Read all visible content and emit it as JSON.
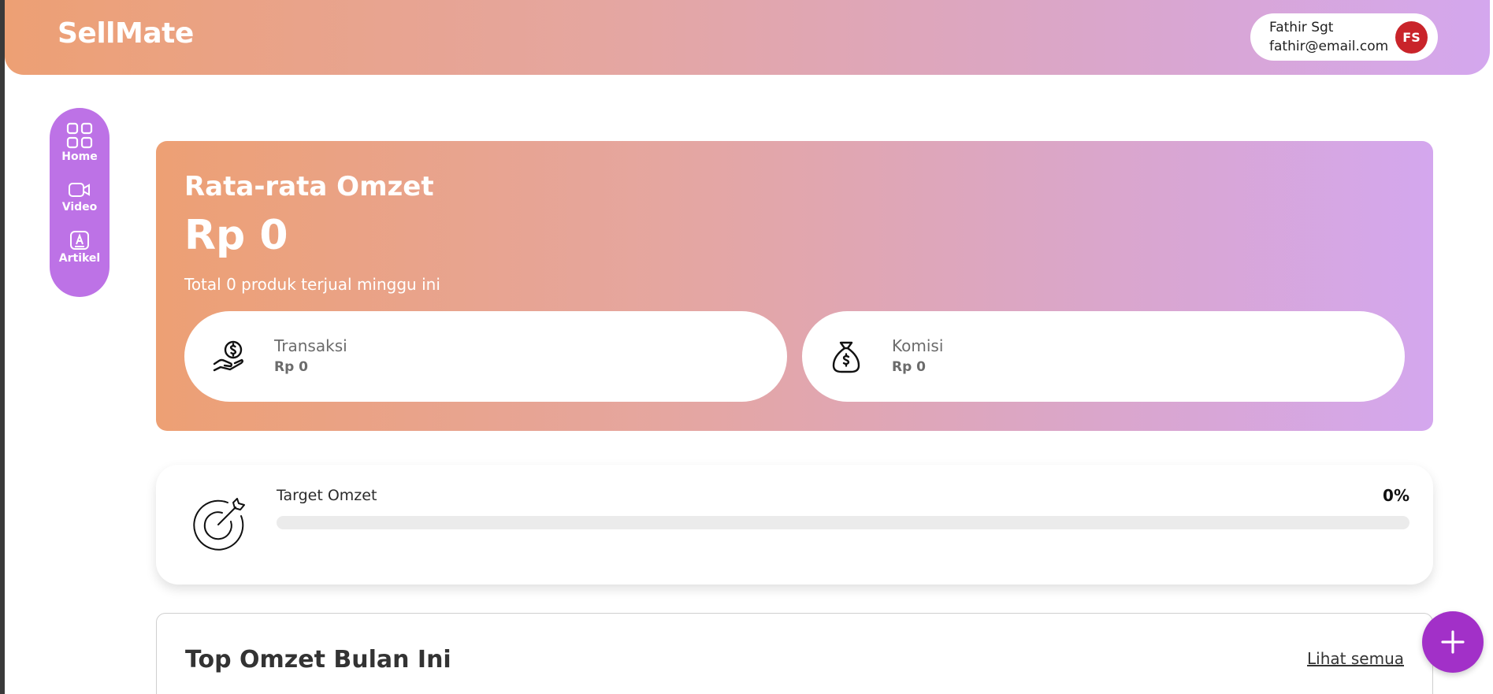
{
  "header": {
    "brand": "SellMate",
    "user": {
      "name": "Fathir Sgt",
      "email": "fathir@email.com",
      "initials": "FS"
    }
  },
  "sidebar": {
    "items": [
      {
        "label": "Home",
        "icon": "grid-icon"
      },
      {
        "label": "Video",
        "icon": "video-icon"
      },
      {
        "label": "Artikel",
        "icon": "article-icon"
      }
    ]
  },
  "hero": {
    "title": "Rata-rata Omzet",
    "value": "Rp 0",
    "subtitle": "Total 0 produk terjual minggu ini",
    "stats": [
      {
        "label": "Transaksi",
        "value": "Rp 0",
        "icon": "hand-coin-icon"
      },
      {
        "label": "Komisi",
        "value": "Rp 0",
        "icon": "money-bag-icon"
      }
    ]
  },
  "target": {
    "label": "Target Omzet",
    "percent_text": "0%",
    "progress": 0,
    "icon": "target-dart-icon"
  },
  "top_omzet": {
    "title": "Top Omzet Bulan Ini",
    "see_all": "Lihat semua"
  },
  "fab": {
    "icon": "plus-icon"
  },
  "colors": {
    "accent": "#bd72e6",
    "fab": "#a230c8",
    "avatar": "#c9242a",
    "gradient_start": "#eda074",
    "gradient_end": "#d4a7ee"
  }
}
